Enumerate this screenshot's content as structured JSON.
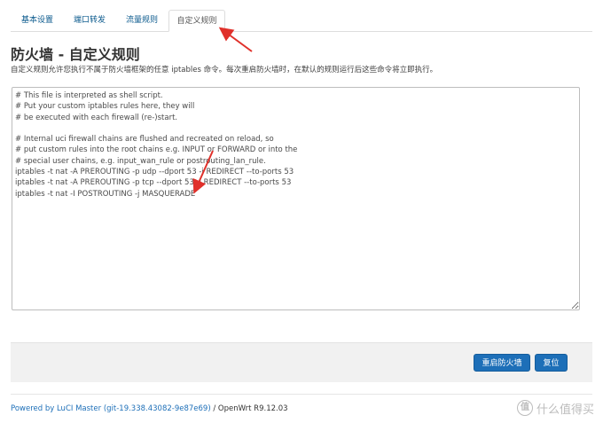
{
  "tabs": [
    {
      "label": "基本设置",
      "active": false
    },
    {
      "label": "端口转发",
      "active": false
    },
    {
      "label": "流量规则",
      "active": false
    },
    {
      "label": "自定义规则",
      "active": true
    }
  ],
  "page": {
    "title": "防火墙 - 自定义规则",
    "description": "自定义规则允许您执行不属于防火墙框架的任意 iptables 命令。每次重启防火墙时，在默认的规则运行后这些命令将立即执行。"
  },
  "editor": {
    "content": "# This file is interpreted as shell script.\n# Put your custom iptables rules here, they will\n# be executed with each firewall (re-)start.\n\n# Internal uci firewall chains are flushed and recreated on reload, so\n# put custom rules into the root chains e.g. INPUT or FORWARD or into the\n# special user chains, e.g. input_wan_rule or postrouting_lan_rule.\niptables -t nat -A PREROUTING -p udp --dport 53 -j REDIRECT --to-ports 53\niptables -t nat -A PREROUTING -p tcp --dport 53 -j REDIRECT --to-ports 53\niptables -t nat -I POSTROUTING -j MASQUERADE"
  },
  "actions": {
    "restart_label": "重启防火墙",
    "reset_label": "复位"
  },
  "footer": {
    "luci_link": "Powered by LuCI Master (git-19.338.43082-9e87e69)",
    "version": " / OpenWrt R9.12.03"
  },
  "watermark": {
    "badge": "值",
    "text": "什么值得买"
  },
  "colors": {
    "link": "#1d6fb8",
    "button": "#1d6fb8",
    "annotation_arrow": "#e0302a"
  }
}
